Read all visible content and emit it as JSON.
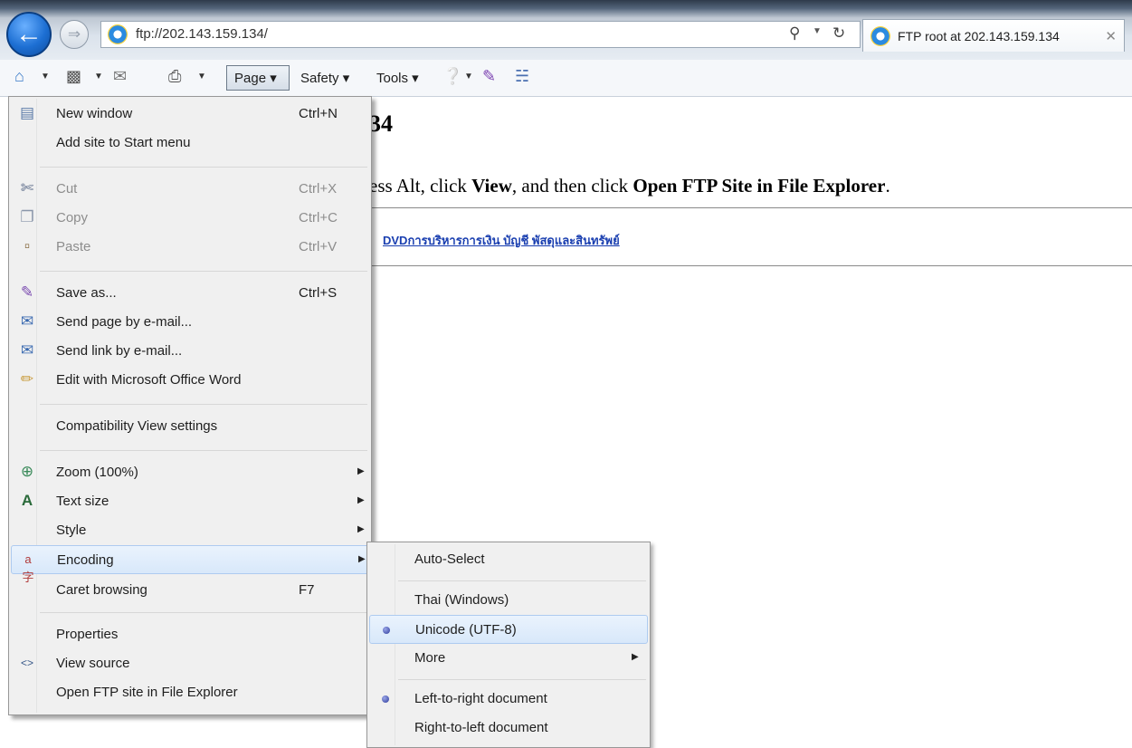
{
  "address_bar": {
    "url": "ftp://202.143.159.134/"
  },
  "tab": {
    "title": "FTP root at 202.143.159.134",
    "close_glyph": "✕"
  },
  "command_bar": {
    "page_label": "Page ▾",
    "safety_label": "Safety ▾",
    "tools_label": "Tools ▾"
  },
  "content": {
    "title_fragment": "34",
    "instruction_prefix": "ess Alt, click ",
    "instruction_view": "View",
    "instruction_middle": ", and then click ",
    "instruction_open": "Open FTP Site in File Explorer",
    "instruction_end": ".",
    "link_text": "DVDการบริหารการเงิน  บัญชี  พัสดุและสินทรัพย์"
  },
  "page_menu": {
    "items": [
      {
        "label": "New window",
        "shortcut": "Ctrl+N"
      },
      {
        "label": "Add site to Start menu",
        "shortcut": ""
      },
      {
        "label": "Cut",
        "shortcut": "Ctrl+X"
      },
      {
        "label": "Copy",
        "shortcut": "Ctrl+C"
      },
      {
        "label": "Paste",
        "shortcut": "Ctrl+V"
      },
      {
        "label": "Save as...",
        "shortcut": "Ctrl+S"
      },
      {
        "label": "Send page by e-mail...",
        "shortcut": ""
      },
      {
        "label": "Send link by e-mail...",
        "shortcut": ""
      },
      {
        "label": "Edit with Microsoft Office Word",
        "shortcut": ""
      },
      {
        "label": "Compatibility View settings",
        "shortcut": ""
      },
      {
        "label": "Zoom (100%)",
        "shortcut": ""
      },
      {
        "label": "Text size",
        "shortcut": ""
      },
      {
        "label": "Style",
        "shortcut": ""
      },
      {
        "label": "Encoding",
        "shortcut": ""
      },
      {
        "label": "Caret browsing",
        "shortcut": "F7"
      },
      {
        "label": "Properties",
        "shortcut": ""
      },
      {
        "label": "View source",
        "shortcut": ""
      },
      {
        "label": "Open FTP site in File Explorer",
        "shortcut": ""
      }
    ]
  },
  "encoding_menu": {
    "items": [
      {
        "label": "Auto-Select"
      },
      {
        "label": "Thai (Windows)"
      },
      {
        "label": "Unicode (UTF-8)"
      },
      {
        "label": "More"
      },
      {
        "label": "Left-to-right document"
      },
      {
        "label": "Right-to-left document"
      }
    ]
  },
  "icons": {
    "back": "arrow-left-icon",
    "forward": "arrow-right-icon",
    "home": "home-icon",
    "feeds": "rss-icon",
    "mail": "mail-icon",
    "print": "printer-icon",
    "help": "help-icon"
  },
  "colors": {
    "link": "#1a3fb0",
    "menu_background": "#f0f0f0",
    "menu_highlight": "#d8e8fa",
    "back_button": "#1d6fd3"
  }
}
